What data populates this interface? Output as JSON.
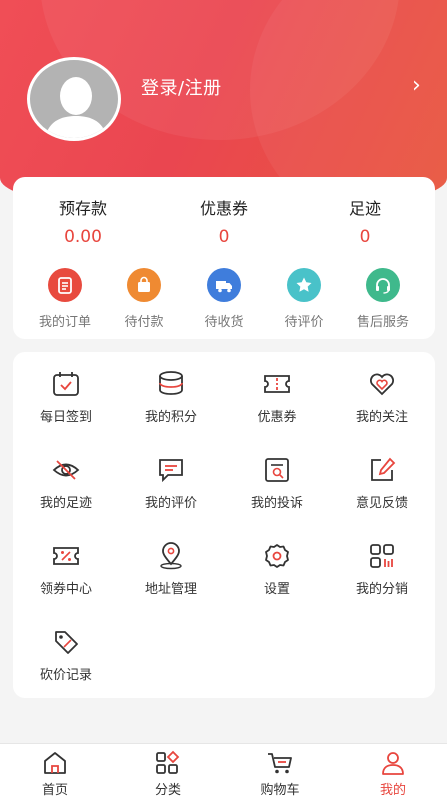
{
  "header": {
    "login_label": "登录/注册",
    "chevron": "›"
  },
  "stats": [
    {
      "label": "预存款",
      "value": "0.00"
    },
    {
      "label": "优惠券",
      "value": "0"
    },
    {
      "label": "足迹",
      "value": "0"
    }
  ],
  "orders": [
    {
      "label": "我的订单",
      "icon": "clipboard-icon",
      "color": "#e84a3e"
    },
    {
      "label": "待付款",
      "icon": "shopping-bag-icon",
      "color": "#ef8a32"
    },
    {
      "label": "待收货",
      "icon": "truck-icon",
      "color": "#3f7ddc"
    },
    {
      "label": "待评价",
      "icon": "star-icon",
      "color": "#49c2c9"
    },
    {
      "label": "售后服务",
      "icon": "headset-icon",
      "color": "#3fb98c"
    }
  ],
  "grid": [
    {
      "label": "每日签到",
      "icon": "calendar-check-icon"
    },
    {
      "label": "我的积分",
      "icon": "coin-stack-icon"
    },
    {
      "label": "优惠券",
      "icon": "ticket-icon"
    },
    {
      "label": "我的关注",
      "icon": "heart-icon"
    },
    {
      "label": "我的足迹",
      "icon": "eye-off-icon"
    },
    {
      "label": "我的评价",
      "icon": "comment-icon"
    },
    {
      "label": "我的投诉",
      "icon": "complaint-icon"
    },
    {
      "label": "意见反馈",
      "icon": "edit-icon"
    },
    {
      "label": "领券中心",
      "icon": "coupon-percent-icon"
    },
    {
      "label": "地址管理",
      "icon": "location-pin-icon"
    },
    {
      "label": "设置",
      "icon": "gear-icon"
    },
    {
      "label": "我的分销",
      "icon": "grid-apps-icon"
    },
    {
      "label": "砍价记录",
      "icon": "price-tag-icon"
    }
  ],
  "tabs": [
    {
      "label": "首页",
      "icon": "home-icon"
    },
    {
      "label": "分类",
      "icon": "category-icon"
    },
    {
      "label": "购物车",
      "icon": "cart-icon"
    },
    {
      "label": "我的",
      "icon": "user-icon",
      "active": true
    }
  ],
  "colors": {
    "accent": "#e8463e",
    "icon_stroke": "#333333",
    "icon_accent": "#e8463e"
  }
}
